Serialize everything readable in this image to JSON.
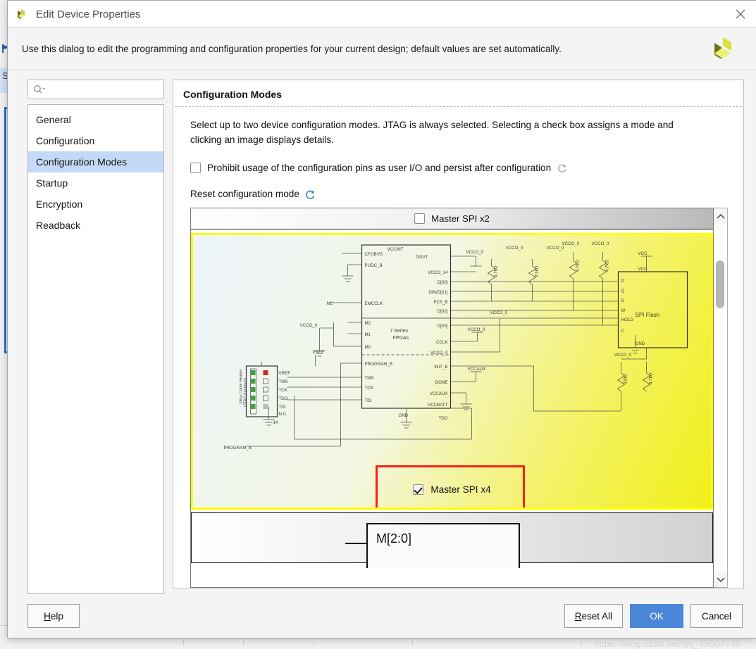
{
  "window": {
    "title": "Edit Device Properties",
    "app_icon": "xilinx-logo-icon",
    "close_icon": "close-icon"
  },
  "header": {
    "text": "Use this dialog to edit the programming and configuration properties for your current design; default values are set automatically.",
    "brand_icon": "xilinx-3d-logo-icon"
  },
  "search": {
    "value": "",
    "placeholder": "",
    "icon": "search-icon"
  },
  "sidebar": {
    "items": [
      {
        "label": "General",
        "selected": false
      },
      {
        "label": "Configuration",
        "selected": false
      },
      {
        "label": "Configuration Modes",
        "selected": true
      },
      {
        "label": "Startup",
        "selected": false
      },
      {
        "label": "Encryption",
        "selected": false
      },
      {
        "label": "Readback",
        "selected": false
      }
    ]
  },
  "panel": {
    "title": "Configuration Modes",
    "description": "Select up to two device configuration modes. JTAG is always selected. Selecting a check box assigns a mode and clicking an image displays details.",
    "prohibit": {
      "label": "Prohibit usage of the configuration pins as user I/O and persist after configuration",
      "checked": false,
      "refresh_icon": "refresh-icon"
    },
    "reset_mode": {
      "label": "Reset configuration mode",
      "refresh_icon": "refresh-icon"
    }
  },
  "modes": {
    "top_partial": {
      "label": "Master SPI x2",
      "checked": false
    },
    "selected_card": {
      "label": "Master SPI x4",
      "checked": true,
      "highlight_color": "#ffff00",
      "annotation_color": "#fc1f12"
    },
    "bottom_partial": {
      "label": "M[2:0]"
    }
  },
  "schematic": {
    "fpga_block": {
      "title_line1": "7 Series",
      "title_line2": "FPGAs",
      "top_label": "VCCINT",
      "left_pins": [
        "CFGBVS",
        "PUDC_B",
        "EMCCLK",
        "M2",
        "M1",
        "M0",
        "PROGRAM_B",
        "TMS",
        "TCK",
        "TDI"
      ],
      "right_pins": [
        "DOUT",
        "VCCO_14",
        "D[00]",
        "DIN/D[01]",
        "FCS_B",
        "D[02]",
        "D[03]",
        "CCLK",
        "VCCO_0",
        "INIT_B",
        "DONE",
        "VCCAUX",
        "VCCBATT",
        "TDO"
      ],
      "bottom_label": "GND"
    },
    "flash_block": {
      "name": "SPI Flash",
      "top_label": "VCC",
      "left_pins": [
        "D",
        "Q",
        "S",
        "W",
        "HOLD",
        "C"
      ],
      "bottom_label": "GND"
    },
    "jtag_header": {
      "caption_line1": "Xilinx Cable Header",
      "caption_line2": "(JTAG Interface)",
      "pin_labels": [
        "VREF",
        "TMS",
        "TCK",
        "TDO",
        "TDI",
        "N.C.",
        "N.C."
      ],
      "top_number": "1",
      "bottom_number": "14",
      "vref_label": "VREF"
    },
    "net_labels": [
      "VCCO_0",
      "VCCO_0",
      "VCCO_0",
      "VCCO_0",
      "VCCO_0",
      "VCCO_0",
      "VCCO_0",
      "VCC",
      "VCCAUX",
      "NC",
      "PROGRAM_B"
    ],
    "resistor_values": [
      "4.7kO",
      "3.3kO",
      "4.7kO",
      "4.7kO",
      "330O",
      "4.7kO"
    ]
  },
  "footer": {
    "help_label": "Help",
    "help_mnemonic": "H",
    "reset_all_label": "Reset All",
    "reset_all_mnemonic": "R",
    "ok_label": "OK",
    "cancel_label": "Cancel",
    "ok_color": "#4b86d8"
  },
  "watermark": {
    "text": "https://blog.csdn.net/qq_39507748"
  },
  "scrollbar": {
    "up_icon": "chevron-up-icon",
    "down_icon": "chevron-down-icon"
  }
}
